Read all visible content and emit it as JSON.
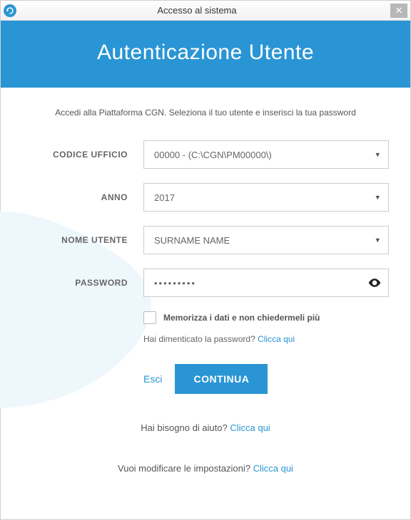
{
  "window": {
    "title": "Accesso al sistema"
  },
  "header": {
    "title": "Autenticazione Utente"
  },
  "instructions": "Accedi alla Piattaforma CGN. Seleziona il tuo utente e inserisci la tua password",
  "form": {
    "office": {
      "label": "CODICE UFFICIO",
      "value": "00000 - (C:\\CGN\\PM00000\\)"
    },
    "year": {
      "label": "ANNO",
      "value": "2017"
    },
    "username": {
      "label": "NOME UTENTE",
      "value": "SURNAME NAME"
    },
    "password": {
      "label": "PASSWORD",
      "value": "•••••••••"
    },
    "remember": {
      "label": "Memorizza i dati e non chiedermeli più"
    },
    "forgot": {
      "text": "Hai dimenticato la password? ",
      "link": "Clicca qui"
    },
    "exit_label": "Esci",
    "continue_label": "CONTINUA"
  },
  "help": {
    "text": "Hai bisogno di aiuto? ",
    "link": "Clicca qui"
  },
  "settings": {
    "text": "Vuoi modificare le impostazioni? ",
    "link": "Clicca qui"
  },
  "colors": {
    "accent": "#2a95d4"
  }
}
